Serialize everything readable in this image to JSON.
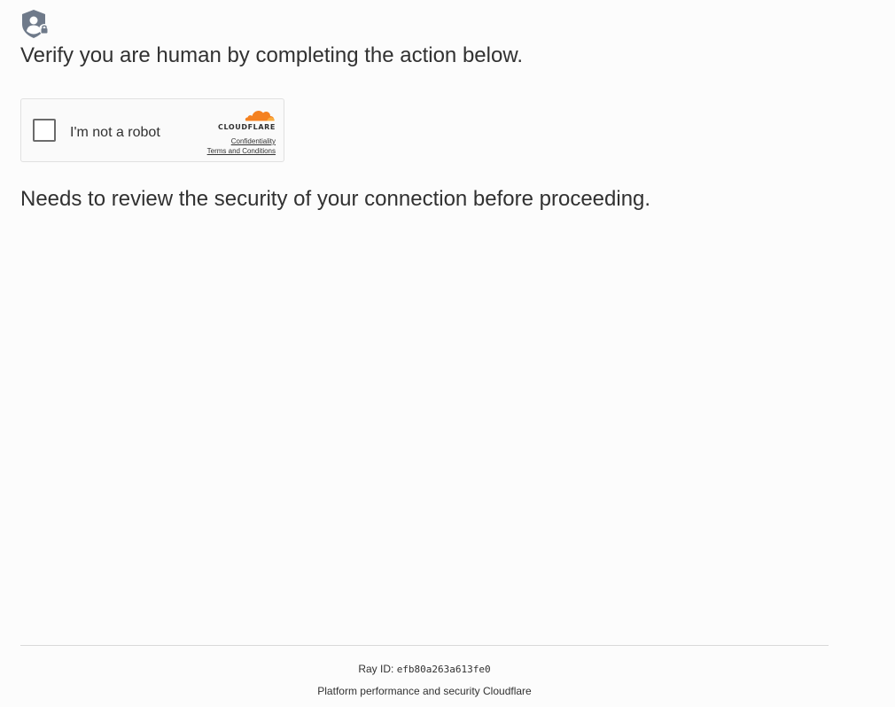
{
  "page": {
    "heading": "Verify you are human by completing the action below.",
    "subheading": "Needs to review the security of your connection before proceeding."
  },
  "widget": {
    "checkbox_label": "I'm not a robot",
    "checked": false,
    "brand_name": "CLOUDFLARE",
    "links": {
      "confidentiality": "Confidentiality",
      "terms": "Terms and Conditions"
    }
  },
  "footer": {
    "ray_label": "Ray ID: ",
    "ray_id": "efb80a263a613fe0",
    "platform_text": "Platform performance and security ",
    "platform_link": "Cloudflare"
  },
  "icons": {
    "top": "shield-user-lock-icon",
    "brand": "cloudflare-cloud-icon"
  },
  "colors": {
    "background": "#fcfcfc",
    "text": "#313131",
    "icon_gray": "#6f7a8a",
    "cloud_orange": "#f48120",
    "cloud_light_orange": "#faad3f"
  }
}
